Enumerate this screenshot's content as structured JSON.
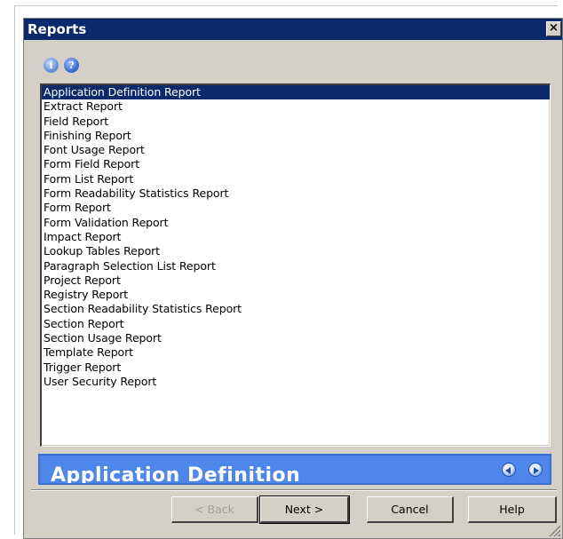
{
  "dialog": {
    "title": "Reports",
    "close_label": "×"
  },
  "toolbar": {
    "info_glyph": "i",
    "help_glyph": "?"
  },
  "reports": {
    "items": [
      "Application Definition Report",
      "Extract Report",
      "Field Report",
      "Finishing Report",
      "Font Usage Report",
      "Form Field Report",
      "Form List Report",
      "Form Readability Statistics Report",
      "Form Report",
      "Form Validation Report",
      "Impact Report",
      "Lookup Tables Report",
      "Paragraph Selection List Report",
      "Project Report",
      "Registry Report",
      "Section Readability Statistics Report",
      "Section Report",
      "Section Usage Report",
      "Template Report",
      "Trigger Report",
      "User Security Report"
    ],
    "selected": "Application Definition Report"
  },
  "description": {
    "title": "Application Definition"
  },
  "buttons": {
    "back": "< Back",
    "next": "Next >",
    "cancel": "Cancel",
    "help": "Help"
  },
  "colors": {
    "titlebar": "#0b2a6b",
    "selection": "#0b2a6b",
    "description_panel": "#4f86ea",
    "dialog_face": "#d4d0c8"
  }
}
